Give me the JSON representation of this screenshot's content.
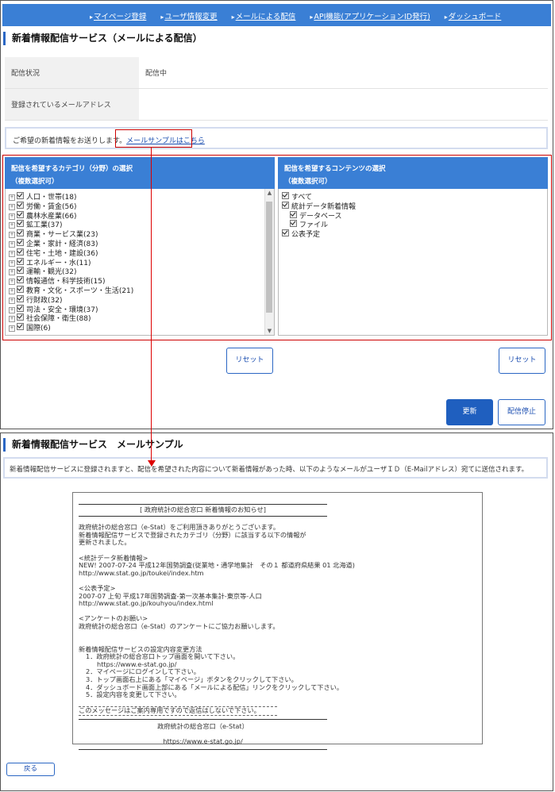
{
  "nav": {
    "items": [
      "マイページ登録",
      "ユーザ情報変更",
      "メールによる配信",
      "API機能(アプリケーションID発行)",
      "ダッシュボード"
    ]
  },
  "settings": {
    "title": "新着情報配信サービス（メールによる配信）",
    "status_label": "配信状況",
    "status_value": "配信中",
    "email_label": "登録されているメールアドレス",
    "email_value": "",
    "intro_text": "ご希望の新着情報をお送りします。",
    "sample_link": "メールサンプルはこちら"
  },
  "category_panel": {
    "header_line1": "配信を希望するカテゴリ（分野）の選択",
    "header_line2": "（複数選択可）",
    "items": [
      "人口・世帯(18)",
      "労働・賃金(56)",
      "農林水産業(66)",
      "鉱工業(37)",
      "商業・サービス業(23)",
      "企業・家計・経済(83)",
      "住宅・土地・建設(36)",
      "エネルギー・水(11)",
      "運輸・観光(32)",
      "情報通信・科学技術(15)",
      "教育・文化・スポーツ・生活(21)",
      "行財政(32)",
      "司法・安全・環境(37)",
      "社会保障・衛生(88)",
      "国際(6)"
    ]
  },
  "content_panel": {
    "header_line1": "配信を希望するコンテンツの選択",
    "header_line2": "（複数選択可）",
    "items": [
      {
        "label": "すべて",
        "level": 0
      },
      {
        "label": "統計データ新着情報",
        "level": 0
      },
      {
        "label": "データベース",
        "level": 1
      },
      {
        "label": "ファイル",
        "level": 1
      },
      {
        "label": "公表予定",
        "level": 0
      }
    ]
  },
  "buttons": {
    "reset": "リセット",
    "update": "更新",
    "stop": "配信停止",
    "back": "戻る"
  },
  "sample": {
    "title": "新着情報配信サービス　メールサンプル",
    "notice": "新着情報配信サービスに登録されますと、配信を希望された内容について新着情報があった時、以下のようなメールがユーザＩＤ（E-Mailアドレス）宛てに送信されます。",
    "mail_header": "[ 政府統計の総合窓口 新着情報のお知らせ]",
    "greeting_1": "政府統計の総合窓口（e-Stat）をご利用頂きありがとうございます。",
    "greeting_2": "新着情報配信サービスで登録されたカテゴリ（分野）に該当する以下の情報が",
    "greeting_3": "更新されました。",
    "data_heading": "<統計データ新着情報>",
    "data_item": "NEW! 2007-07-24 平成12年国勢調査(従業地・通学地集計　その１ 都道府県結果 01 北海道)",
    "data_url": "http://www.stat.go.jp/toukei/index.htm",
    "schedule_heading": "<公表予定>",
    "schedule_item": "2007-07 上旬 平成17年国勢調査-第一次基本集計-東京等-人口",
    "schedule_url": "http://www.stat.go.jp/kouhyou/index.html",
    "survey_heading": "<アンケートのお願い>",
    "survey_text": "政府統計の総合窓口（e-Stat）のアンケートにご協力お願いします。",
    "howto_heading": "新着情報配信サービスの設定内容変更方法",
    "steps": [
      "1．政府統計の総合窓口トップ画面を開いて下さい。",
      "2．マイページにログインして下さい。",
      "3．トップ画面右上にある「マイページ」ボタンをクリックして下さい。",
      "4．ダッシュボード画面上部にある「メールによる配信」リンクをクリックして下さい。",
      "5．設定内容を変更して下さい。"
    ],
    "step1_url": "https://www.e-stat.go.jp/",
    "no_reply": "このメッセージはご案内専用ですので返信はしないで下さい。",
    "footer_name": "政府統計の総合窓口（e-Stat）",
    "footer_url": "https://www.e-stat.go.jp/"
  },
  "colors": {
    "primary": "#3a7fd5",
    "highlight": "#cc0000"
  }
}
